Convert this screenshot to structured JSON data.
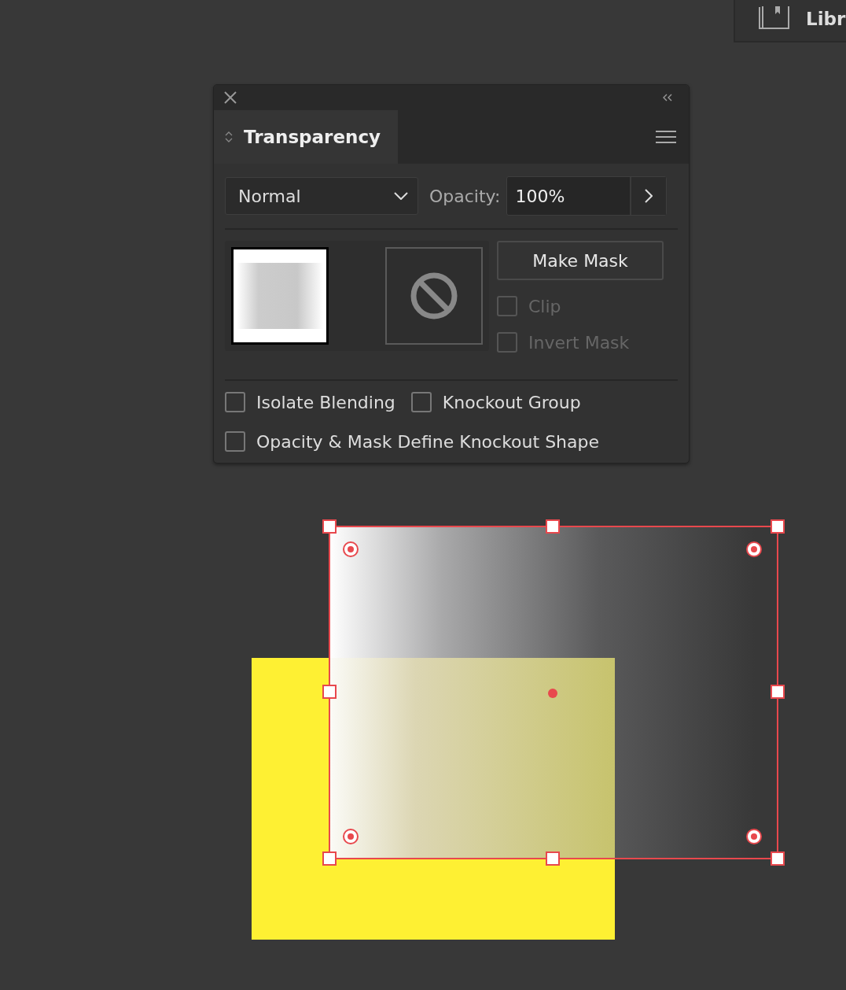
{
  "library_tab": {
    "label": "Libr"
  },
  "panel": {
    "title": "Transparency",
    "blend_mode": {
      "value": "Normal"
    },
    "opacity": {
      "label": "Opacity:",
      "value": "100%"
    },
    "make_mask_button": "Make Mask",
    "mask_options": [
      {
        "label": "Clip",
        "checked": false,
        "disabled": true
      },
      {
        "label": "Invert Mask",
        "checked": false,
        "disabled": true
      }
    ],
    "options": [
      {
        "label": "Isolate Blending",
        "checked": false
      },
      {
        "label": "Knockout Group",
        "checked": false
      },
      {
        "label": "Opacity & Mask Define Knockout Shape",
        "checked": false
      }
    ]
  }
}
